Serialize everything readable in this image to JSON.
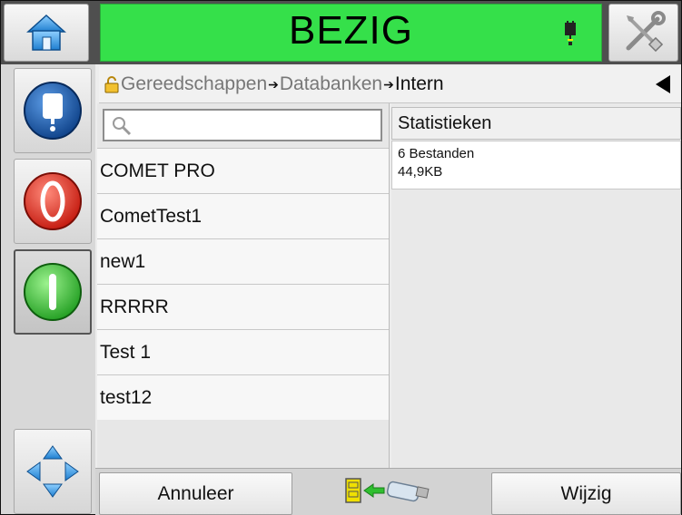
{
  "status": {
    "label": "BEZIG",
    "color": "#35e04a"
  },
  "breadcrumb": {
    "seg1": "Gereedschappen",
    "sep": "➔",
    "seg2": "Databanken",
    "seg3": "Intern"
  },
  "search": {
    "placeholder": ""
  },
  "list": {
    "items": [
      "COMET PRO",
      "CometTest1",
      "new1",
      "RRRRR",
      "Test 1",
      "test12"
    ]
  },
  "stats": {
    "header": "Statistieken",
    "line1": "6 Bestanden",
    "line2": "44,9KB"
  },
  "buttons": {
    "cancel": "Annuleer",
    "edit": "Wijzig"
  },
  "icons": {
    "home": "home-icon",
    "tools": "tools-icon",
    "plug": "plug-icon",
    "lock": "lock-icon",
    "back": "back-arrow-icon",
    "search": "search-icon",
    "usb": "usb-transfer-icon",
    "ink": "ink-bottle-icon",
    "stop": "stop-icon",
    "start": "start-icon",
    "nav": "navigation-arrows-icon"
  }
}
